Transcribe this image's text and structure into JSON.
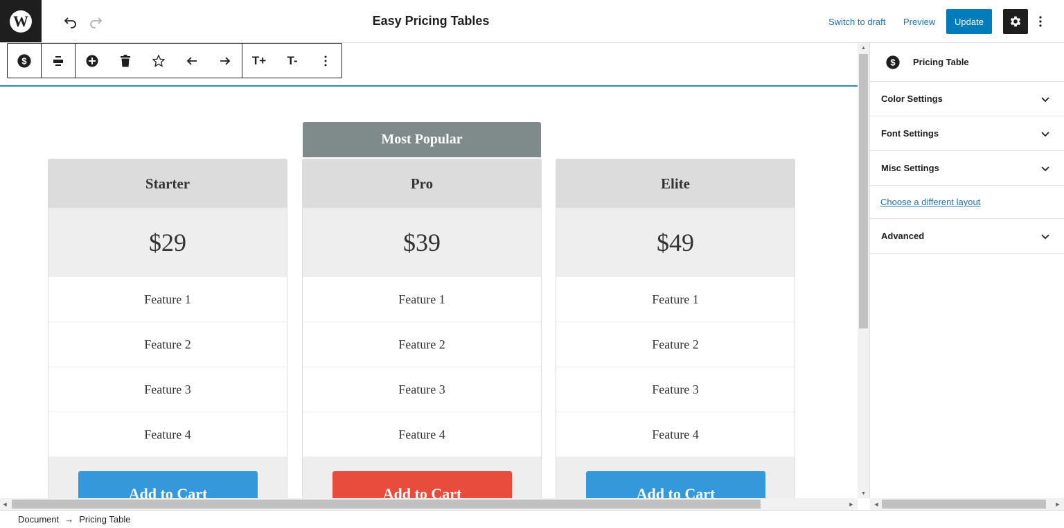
{
  "header": {
    "logo_letter": "W",
    "title": "Easy Pricing Tables",
    "switch_to_draft": "Switch to draft",
    "preview": "Preview",
    "update": "Update"
  },
  "block_toolbar": {
    "icons": [
      "dollar-icon",
      "align-icon",
      "add-circle-icon",
      "trash-icon",
      "star-icon",
      "arrow-left-icon",
      "arrow-right-icon",
      "text-increase-icon",
      "text-decrease-icon",
      "more-vertical-icon"
    ],
    "text_increase_label": "T+",
    "text_decrease_label": "T-"
  },
  "pricing": {
    "badge": "Most Popular",
    "plans": [
      {
        "name": "Starter",
        "price": "$29",
        "features": [
          "Feature 1",
          "Feature 2",
          "Feature 3",
          "Feature 4"
        ],
        "button": "Add to Cart",
        "button_color": "#3498db"
      },
      {
        "name": "Pro",
        "price": "$39",
        "features": [
          "Feature 1",
          "Feature 2",
          "Feature 3",
          "Feature 4"
        ],
        "button": "Add to Cart",
        "button_color": "#e74c3c"
      },
      {
        "name": "Elite",
        "price": "$49",
        "features": [
          "Feature 1",
          "Feature 2",
          "Feature 3",
          "Feature 4"
        ],
        "button": "Add to Cart",
        "button_color": "#3498db"
      }
    ]
  },
  "sidebar": {
    "block_name": "Pricing Table",
    "panels": [
      "Color Settings",
      "Font Settings",
      "Misc Settings"
    ],
    "layout_link": "Choose a different layout",
    "advanced": "Advanced"
  },
  "footer": {
    "breadcrumb": [
      "Document",
      "Pricing Table"
    ],
    "separator": "→"
  },
  "colors": {
    "accent": "#007cba",
    "link": "#2271b1",
    "badge_bg": "#7f8b8b",
    "dark": "#1e1e1e"
  }
}
